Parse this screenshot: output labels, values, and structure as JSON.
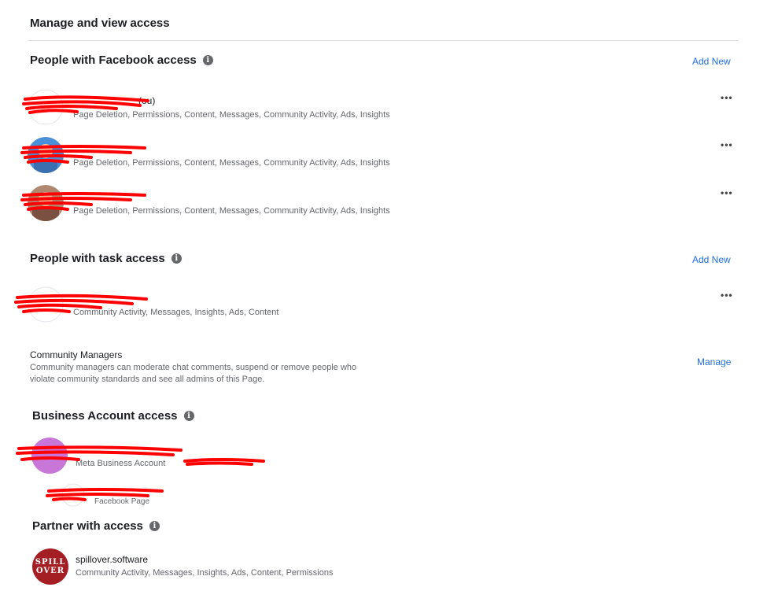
{
  "page_title": "Manage and view access",
  "facebook_access": {
    "title": "People with Facebook access",
    "add_new": "Add New",
    "people": [
      {
        "name_visible": "(ou)",
        "permissions": "Page Deletion, Permissions, Content, Messages, Community Activity, Ads, Insights"
      },
      {
        "name_visible": "",
        "permissions": "Page Deletion, Permissions, Content, Messages, Community Activity, Ads, Insights"
      },
      {
        "name_visible": "",
        "permissions": "Page Deletion, Permissions, Content, Messages, Community Activity, Ads, Insights"
      }
    ]
  },
  "task_access": {
    "title": "People with task access",
    "add_new": "Add New",
    "people": [
      {
        "permissions": "Community Activity, Messages, Insights, Ads, Content"
      }
    ]
  },
  "community_managers": {
    "title": "Community Managers",
    "description": "Community managers can moderate chat comments, suspend or remove people who violate community standards and see all admins of this Page.",
    "manage": "Manage"
  },
  "business_access": {
    "title": "Business Account access",
    "account_type": "Meta Business Account",
    "page_type": "Facebook Page"
  },
  "partner_access": {
    "title": "Partner with access",
    "partner_name": "spillover.software",
    "permissions": "Community Activity, Messages, Insights, Ads, Content, Permissions",
    "logo_line1": "SPILL",
    "logo_line2": "OVER"
  },
  "icons": {
    "info": "info-icon",
    "more": "more-options-icon"
  },
  "colors": {
    "link": "#216fdb",
    "redaction": "#ff0000",
    "spillover_brand": "#a31f24"
  }
}
